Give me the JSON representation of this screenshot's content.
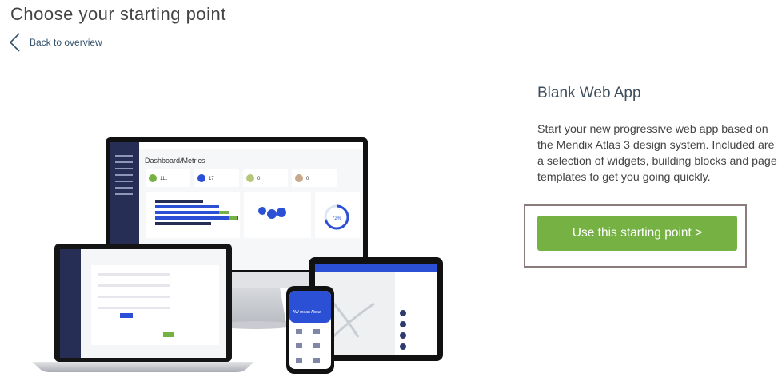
{
  "page": {
    "title": "Choose your starting point"
  },
  "nav": {
    "back_label": "Back to overview"
  },
  "detail": {
    "title": "Blank Web App",
    "description": "Start your new progressive web app based on the Mendix Atlas 3 design system. Included are a selection of widgets, building blocks and page templates to get you going quickly.",
    "cta_label": "Use this starting point >"
  },
  "preview": {
    "dashboard_title": "Dashboard/Metrics",
    "stats": [
      "111",
      "17",
      "0",
      "0"
    ],
    "gauge_value": "72%",
    "phone_heading": "AW mean About"
  },
  "colors": {
    "accent": "#76b243",
    "brand_navy": "#272e55",
    "primary_blue": "#2b50d6",
    "highlight_border": "#8c7b7b"
  }
}
